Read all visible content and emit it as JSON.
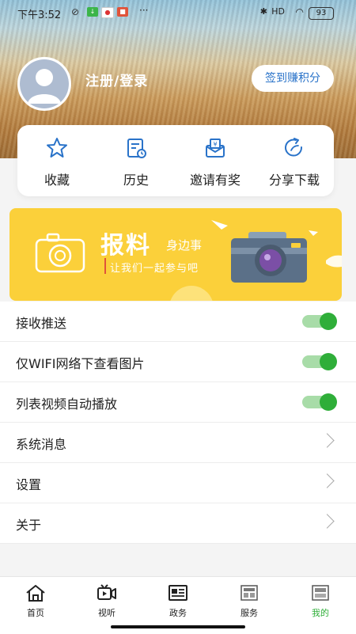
{
  "status_bar": {
    "time": "下午3:52",
    "network": "HD",
    "battery": "93",
    "more": "···"
  },
  "profile": {
    "login_label": "注册/登录",
    "signin_button": "签到赚积分"
  },
  "quick_actions": [
    {
      "label": "收藏",
      "icon": "star-icon"
    },
    {
      "label": "历史",
      "icon": "history-icon"
    },
    {
      "label": "邀请有奖",
      "icon": "invite-icon"
    },
    {
      "label": "分享下载",
      "icon": "share-icon"
    }
  ],
  "banner": {
    "title": "报料",
    "subtitle": "身边事",
    "slogan": "让我们一起参与吧",
    "colors": {
      "background": "#fbd03a"
    }
  },
  "settings": [
    {
      "label": "接收推送",
      "type": "toggle",
      "on": true
    },
    {
      "label": "仅WIFI网络下查看图片",
      "type": "toggle",
      "on": true
    },
    {
      "label": "列表视频自动播放",
      "type": "toggle",
      "on": true
    },
    {
      "label": "系统消息",
      "type": "link"
    },
    {
      "label": "设置",
      "type": "link"
    },
    {
      "label": "关于",
      "type": "link"
    }
  ],
  "tabs": [
    {
      "label": "首页",
      "icon": "home-icon"
    },
    {
      "label": "视听",
      "icon": "video-icon"
    },
    {
      "label": "政务",
      "icon": "news-icon"
    },
    {
      "label": "服务",
      "icon": "service-icon"
    },
    {
      "label": "我的",
      "icon": "profile-icon",
      "active": true
    }
  ],
  "colors": {
    "accent": "#2fae39",
    "link_blue": "#2a73c9",
    "toggle_track": "#a8dca8"
  }
}
